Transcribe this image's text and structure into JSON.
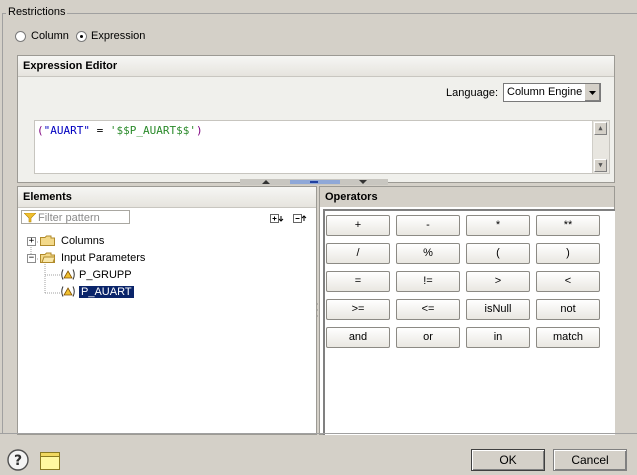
{
  "restrictions": {
    "title": "Restrictions",
    "options": [
      {
        "label": "Column",
        "checked": false
      },
      {
        "label": "Expression",
        "checked": true
      }
    ]
  },
  "expression_editor": {
    "title": "Expression Editor",
    "language_label": "Language:",
    "language_value": "Column Engine",
    "expression_parts": [
      {
        "text": "(",
        "color": "#7f007f"
      },
      {
        "text": "\"AUART\"",
        "color": "#0000c0"
      },
      {
        "text": " = ",
        "color": "#000000"
      },
      {
        "text": "'$$P_AUART$$'",
        "color": "#2a8a2a"
      },
      {
        "text": ")",
        "color": "#7f007f"
      }
    ]
  },
  "elements": {
    "title": "Elements",
    "filter_placeholder": "Filter pattern",
    "tree": [
      {
        "label": "Columns",
        "type": "folder",
        "expanded": false
      },
      {
        "label": "Input Parameters",
        "type": "folder",
        "expanded": true
      },
      {
        "label": "P_GRUPP",
        "type": "parameter",
        "selected": false
      },
      {
        "label": "P_AUART",
        "type": "parameter",
        "selected": true
      }
    ]
  },
  "operators": {
    "title": "Operators",
    "buttons": [
      [
        "+",
        "-",
        "*",
        "**"
      ],
      [
        "/",
        "%",
        "(",
        ")"
      ],
      [
        "=",
        "!=",
        ">",
        "<"
      ],
      [
        ">=",
        "<=",
        "isNull",
        "not"
      ],
      [
        "and",
        "or",
        "in",
        "match"
      ]
    ]
  },
  "footer": {
    "ok_label": "OK",
    "cancel_label": "Cancel",
    "help_icon": "help-icon",
    "note_icon": "note-icon"
  },
  "colors": {
    "selection": "#0a246a",
    "dialog_bg": "#d4d0c8"
  }
}
